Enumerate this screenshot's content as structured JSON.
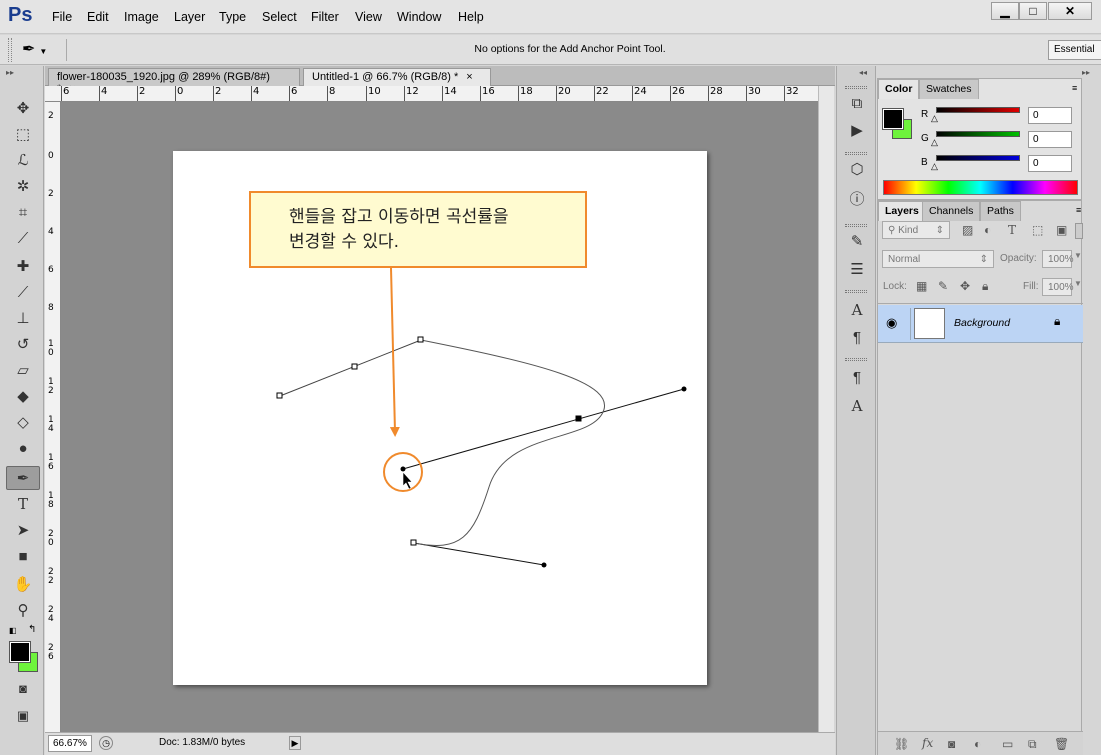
{
  "app": {
    "logo": "Ps"
  },
  "menu": [
    "File",
    "Edit",
    "Image",
    "Layer",
    "Type",
    "Select",
    "Filter",
    "View",
    "Window",
    "Help"
  ],
  "window_buttons": {
    "minimize": "▁",
    "maximize": "□",
    "close": "✕"
  },
  "options_bar": {
    "tool_icon": "add-anchor-point-pen",
    "message": "No options for the Add Anchor Point Tool.",
    "workspace": "Essential"
  },
  "documents": {
    "tabs": [
      {
        "label": "flower-180035_1920.jpg @ 289% (RGB/8#) *",
        "close": "×",
        "active": false
      },
      {
        "label": "Untitled-1 @ 66.7% (RGB/8) *",
        "close": "×",
        "active": true
      }
    ]
  },
  "rulers": {
    "top": [
      "6",
      "4",
      "2",
      "0",
      "2",
      "4",
      "6",
      "8",
      "10",
      "12",
      "14",
      "16",
      "18",
      "20",
      "22",
      "24",
      "26",
      "28",
      "30",
      "32"
    ],
    "left": [
      "2",
      "0",
      "2",
      "4",
      "6",
      "8",
      "10",
      "12",
      "14",
      "16",
      "18",
      "20",
      "22",
      "24",
      "26"
    ]
  },
  "callout": {
    "line1": "핸들을 잡고 이동하면 곡선률을",
    "line2": "변경할 수 있다."
  },
  "status": {
    "zoom": "66.67%",
    "doc": "Doc: 1.83M/0 bytes"
  },
  "color_panel": {
    "tabs": [
      "Color",
      "Swatches"
    ],
    "channels": [
      {
        "label": "R",
        "value": "0",
        "color": "#e00000"
      },
      {
        "label": "G",
        "value": "0",
        "color": "#00c000"
      },
      {
        "label": "B",
        "value": "0",
        "color": "#0000e0"
      }
    ],
    "foreground": "#000000",
    "background": "#6ef33c"
  },
  "layers_panel": {
    "tabs": [
      "Layers",
      "Channels",
      "Paths"
    ],
    "kind": "Kind",
    "blend_mode": "Normal",
    "opacity_label": "Opacity:",
    "opacity": "100%",
    "lock_label": "Lock:",
    "fill_label": "Fill:",
    "fill": "100%",
    "layer_name": "Background"
  }
}
